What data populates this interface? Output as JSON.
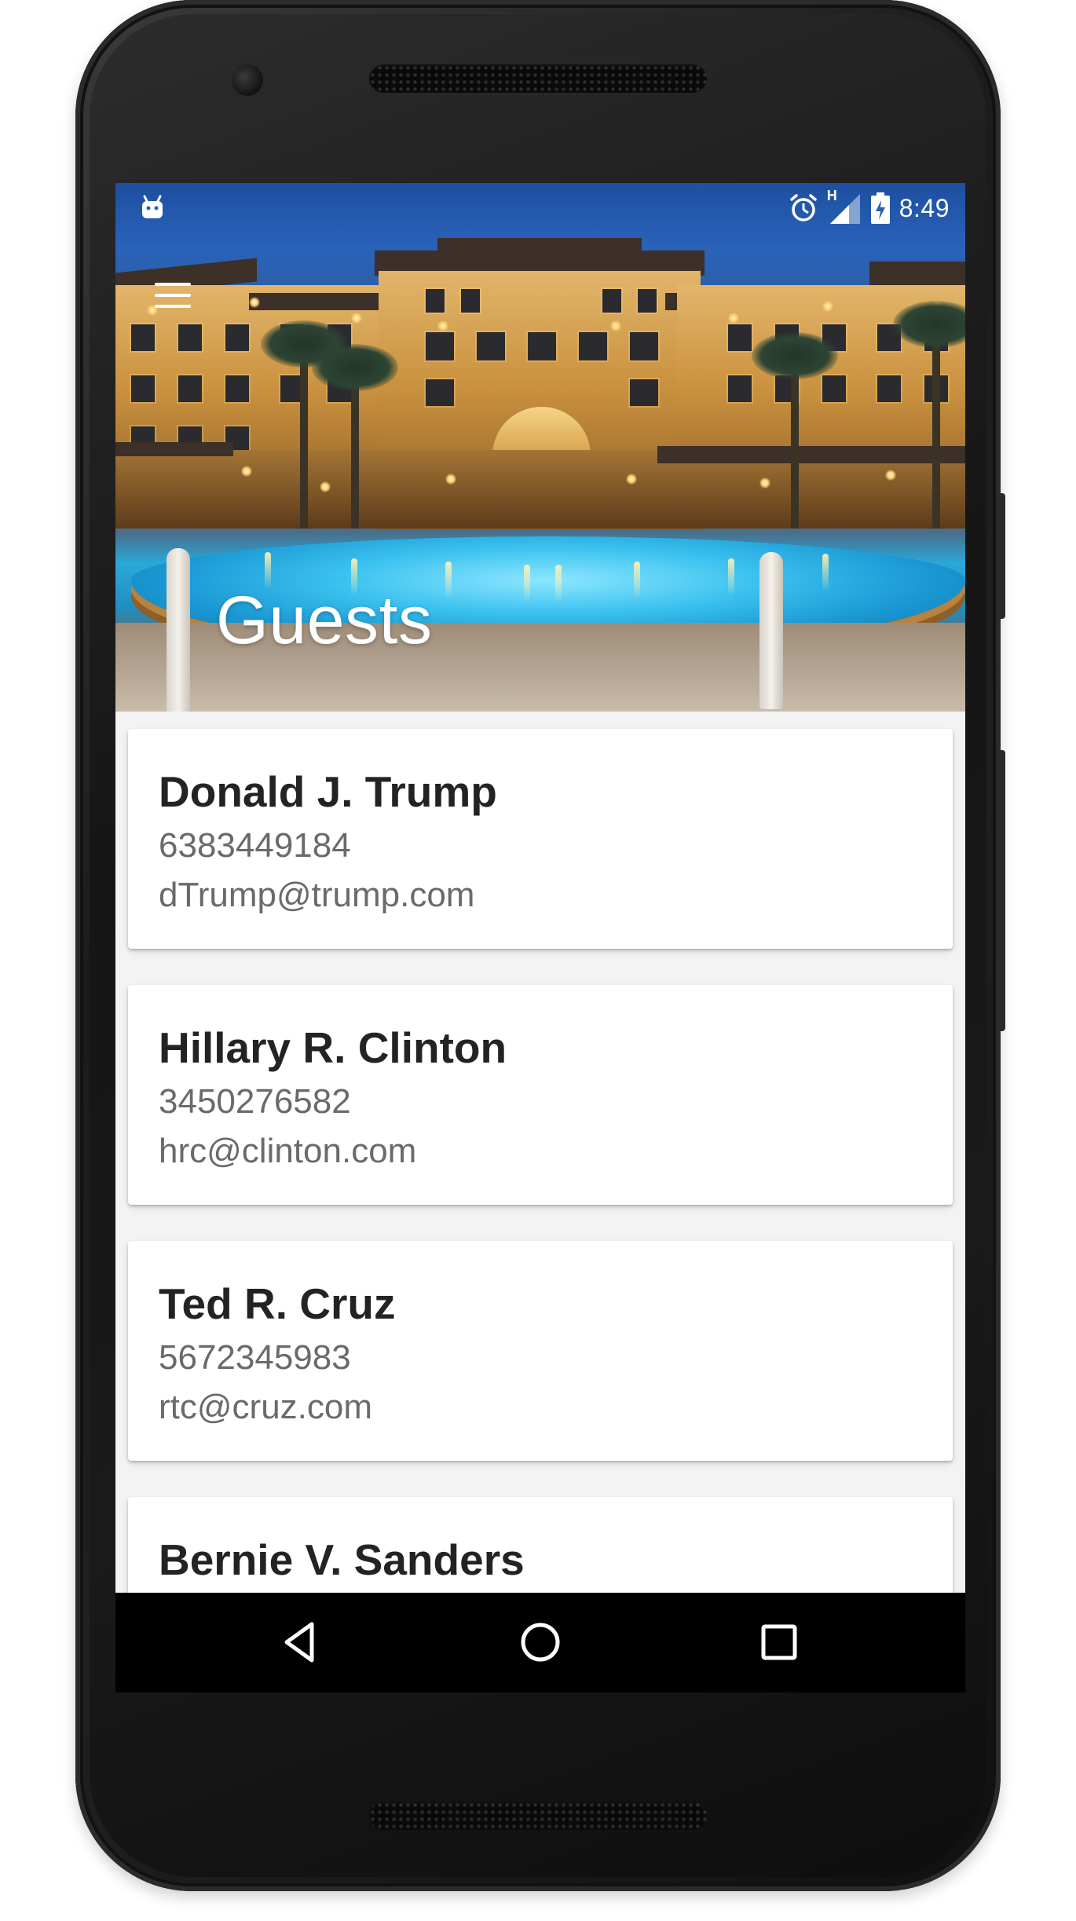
{
  "status_bar": {
    "time": "8:49",
    "network_label": "H",
    "icons": [
      "android-debug-icon",
      "alarm-icon",
      "signal-icon",
      "battery-charging-icon"
    ]
  },
  "header": {
    "title": "Guests",
    "menu_icon": "hamburger-menu-icon"
  },
  "guests": [
    {
      "name": "Donald J. Trump",
      "phone": "6383449184",
      "email": "dTrump@trump.com"
    },
    {
      "name": "Hillary R. Clinton",
      "phone": "3450276582",
      "email": "hrc@clinton.com"
    },
    {
      "name": "Ted R. Cruz",
      "phone": "5672345983",
      "email": "rtc@cruz.com"
    },
    {
      "name": "Bernie V. Sanders",
      "phone": "",
      "email": ""
    }
  ],
  "nav_bar": {
    "icons": [
      "back-icon",
      "home-icon",
      "recents-icon"
    ]
  }
}
